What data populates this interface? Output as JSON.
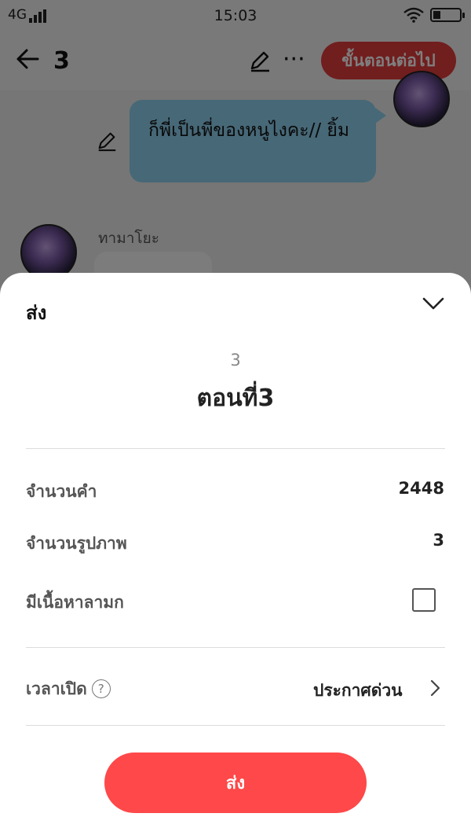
{
  "status_bar": {
    "network": "4G",
    "time": "15:03"
  },
  "topbar": {
    "episode_number": "3",
    "next_button_label": "ขั้นตอนต่อไป"
  },
  "chat": {
    "bubble_text": "ก็พี่เป็นพี่ของหนูไงคะ// ยิ้ม",
    "character_name": "ทามาโยะ"
  },
  "sheet": {
    "title": "ส่ง",
    "episode_number": "3",
    "episode_title": "ตอนที่3",
    "rows": [
      {
        "label": "จำนวนคำ",
        "value": "2448"
      },
      {
        "label": "จำนวนรูปภาพ",
        "value": "3"
      },
      {
        "label": "มีเนื้อหาลามก"
      }
    ],
    "publish_time": {
      "label": "เวลาเปิด",
      "value": "ประกาศด่วน"
    },
    "send_button_label": "ส่ง"
  },
  "icons": [
    "back-arrow-icon",
    "edit-icon",
    "more-icon",
    "chevron-down-icon",
    "help-icon",
    "chevron-right-icon",
    "wifi-icon",
    "battery-icon",
    "signal-icon"
  ],
  "colors": {
    "accent_red": "#fe4849",
    "next_button_red": "#e23c3c",
    "bubble_blue": "#8ed1ef"
  }
}
